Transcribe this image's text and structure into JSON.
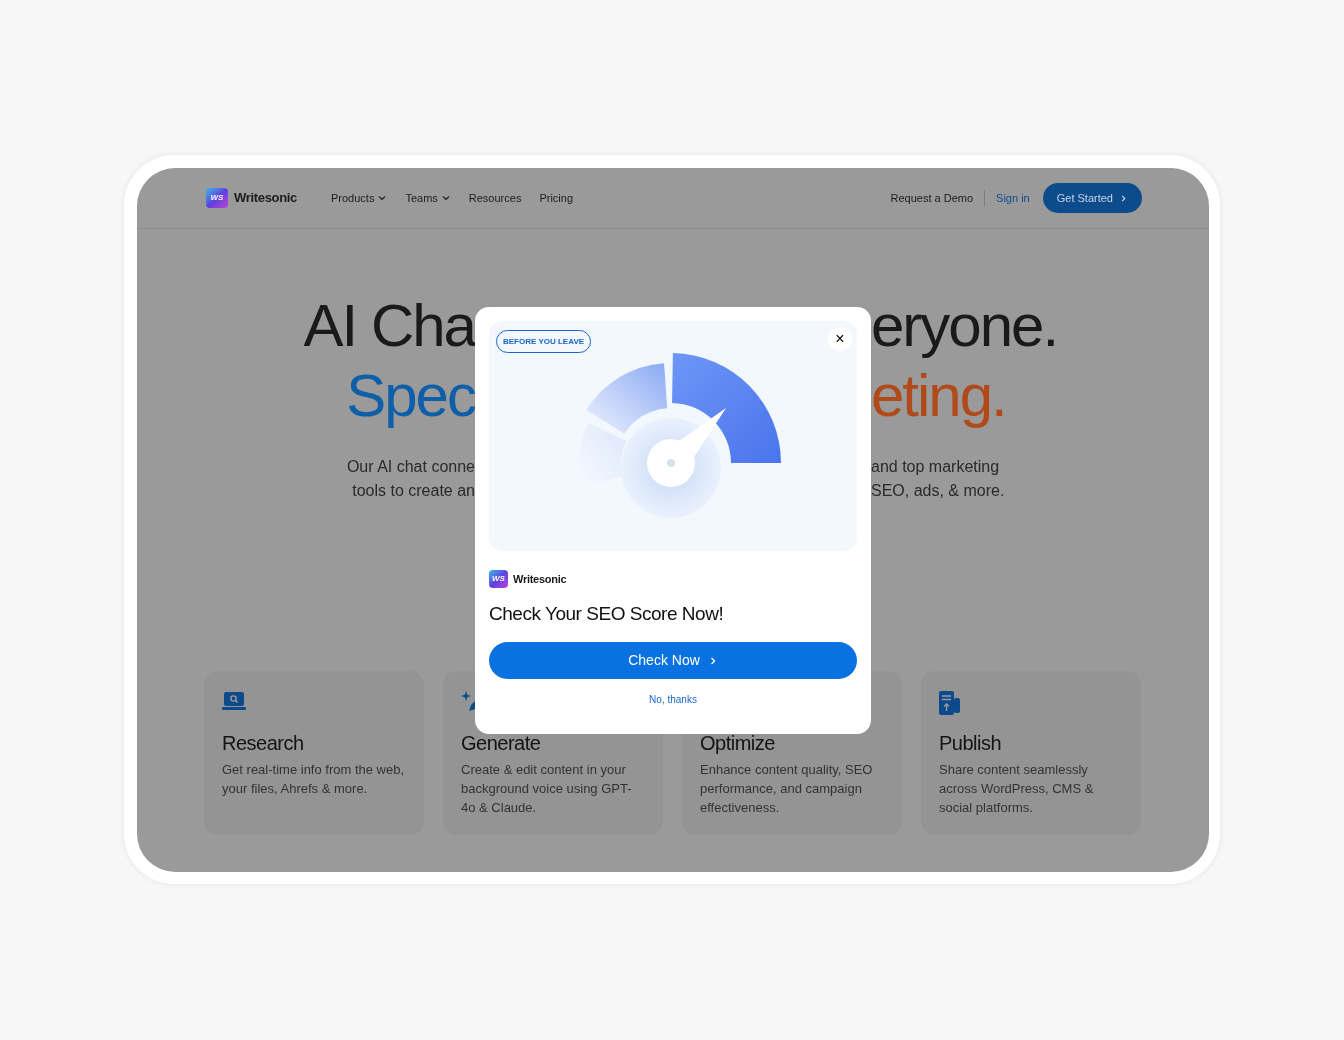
{
  "nav": {
    "logo_mark": "WS",
    "brand": "Writesonic",
    "items": [
      {
        "label": "Products",
        "dropdown": true
      },
      {
        "label": "Teams",
        "dropdown": true
      },
      {
        "label": "Resources",
        "dropdown": false
      },
      {
        "label": "Pricing",
        "dropdown": false
      }
    ],
    "request_demo": "Request a Demo",
    "sign_in": "Sign in",
    "get_started": "Get Started"
  },
  "hero": {
    "line1_left": "AI Cha",
    "line1_right": "eryone.",
    "line2_left": "Spec",
    "line2_right": "eting.",
    "paragraph_left": [
      "Our AI chat conne",
      "tools to create an"
    ],
    "paragraph_right": [
      "and top marketing",
      "SEO, ads, & more."
    ]
  },
  "cards": [
    {
      "title": "Research",
      "text": "Get real-time info from the web, your files, Ahrefs & more."
    },
    {
      "title": "Generate",
      "text": "Create & edit content in your background voice using GPT-4o & Claude."
    },
    {
      "title": "Optimize",
      "text": "Enhance content quality, SEO performance, and campaign effectiveness."
    },
    {
      "title": "Publish",
      "text": "Share content seamlessly across WordPress, CMS & social platforms."
    }
  ],
  "modal": {
    "badge": "BEFORE YOU LEAVE",
    "close": "×",
    "logo_mark": "WS",
    "brand": "Writesonic",
    "title": "Check Your SEO Score Now!",
    "primary_button": "Check Now",
    "dismiss": "No, thanks"
  }
}
